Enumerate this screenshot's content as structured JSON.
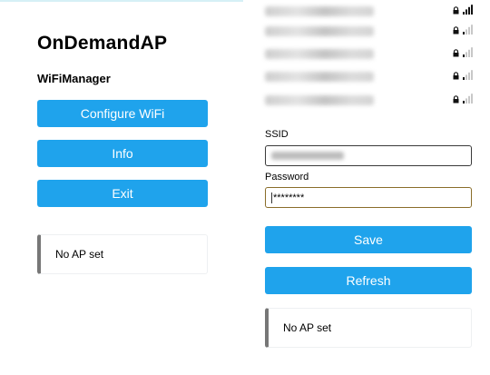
{
  "left_panel": {
    "title": "OnDemandAP",
    "subtitle": "WiFiManager",
    "buttons": {
      "configure": "Configure WiFi",
      "info": "Info",
      "exit": "Exit"
    },
    "status_message": "No AP set"
  },
  "right_panel": {
    "networks": [
      {
        "signal_level": 4,
        "locked": true
      },
      {
        "signal_level": 1,
        "locked": true
      },
      {
        "signal_level": 1,
        "locked": true
      },
      {
        "signal_level": 1,
        "locked": true
      },
      {
        "signal_level": 1,
        "locked": true
      }
    ],
    "form": {
      "ssid_label": "SSID",
      "password_label": "Password",
      "password_value": "********"
    },
    "buttons": {
      "save": "Save",
      "refresh": "Refresh"
    },
    "status_message": "No AP set"
  },
  "colors": {
    "accent": "#1fa3ec",
    "status_bar": "#777777"
  },
  "icons": {
    "lock": "lock-icon",
    "signal": "signal-strength-icon"
  }
}
